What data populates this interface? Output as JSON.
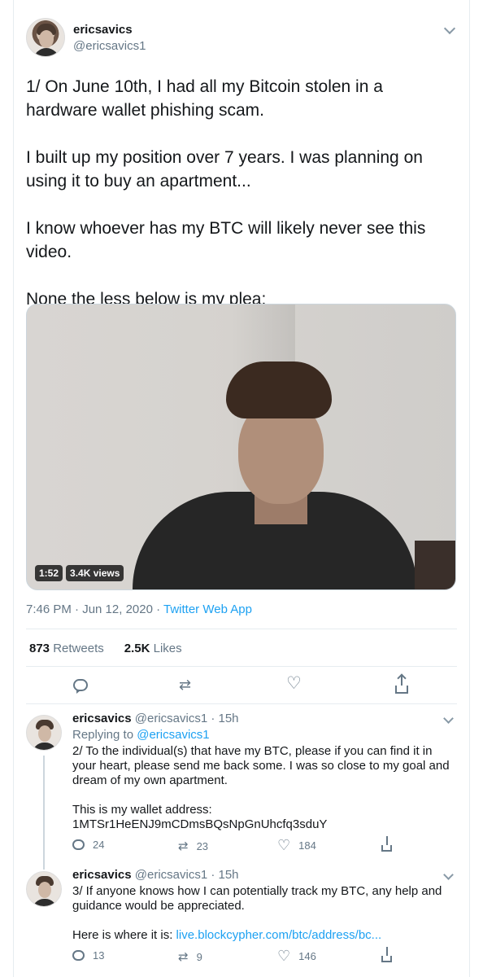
{
  "main_tweet": {
    "display_name": "ericsavics",
    "handle": "@ericsavics1",
    "text": "1/ On June 10th, I had all my Bitcoin stolen in a hardware wallet phishing scam.\n\nI built up my position over 7 years. I was planning on using it to buy an apartment...\n\nI know whoever has my BTC will likely never see this video.\n\nNone the less below is my plea:",
    "video_duration": "1:52",
    "video_views": "3.4K views",
    "timestamp": "7:46 PM · Jun 12, 2020 · ",
    "source": "Twitter Web App",
    "retweets_count": "873",
    "retweets_label": "Retweets",
    "likes_count": "2.5K",
    "likes_label": "Likes"
  },
  "replies": [
    {
      "display_name": "ericsavics",
      "handle_time": "@ericsavics1 · 15h",
      "replying_prefix": "Replying to ",
      "replying_to": "@ericsavics1",
      "text": "2/ To the individual(s) that have my BTC, please if you can find it in your heart, please send me back some. I was so close to my goal and dream of my own apartment.\n\nThis is my wallet address:\n1MTSr1HeENJ9mCDmsBQsNpGnUhcfq3sduY",
      "reply_count": "24",
      "retweet_count": "23",
      "like_count": "184"
    },
    {
      "display_name": "ericsavics",
      "handle_time": "@ericsavics1 · 15h",
      "text": "3/ If anyone knows how I can potentially track my BTC, any help and guidance would be appreciated.\n\nHere is where it is: ",
      "link": "live.blockcypher.com/btc/address/bc...",
      "reply_count": "13",
      "retweet_count": "9",
      "like_count": "146"
    }
  ],
  "icons": [
    "chevron-down-icon",
    "reply-icon",
    "retweet-icon",
    "like-icon",
    "share-icon"
  ],
  "colors": {
    "link": "#1da1f2",
    "muted": "#657786",
    "border": "#e6ecf0"
  }
}
